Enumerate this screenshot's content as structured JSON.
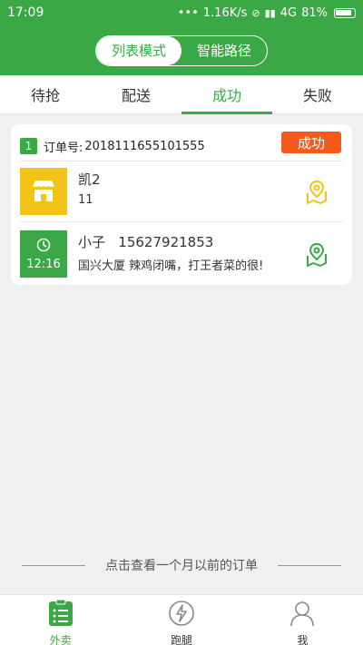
{
  "status_bar": {
    "time": "17:09",
    "dots": "•••",
    "speed": "1.16K/s",
    "network": "4G",
    "battery": "81%"
  },
  "header": {
    "modes": [
      {
        "label": "列表模式",
        "active": true
      },
      {
        "label": "智能路径",
        "active": false
      }
    ]
  },
  "tabs": [
    {
      "label": "待抢"
    },
    {
      "label": "配送"
    },
    {
      "label": "成功",
      "active": true
    },
    {
      "label": "失败"
    }
  ],
  "order": {
    "index": "1",
    "number_label": "订单号:",
    "number": "2018111655101555",
    "status": "成功",
    "pickup": {
      "name": "凯2",
      "address": "11"
    },
    "delivery": {
      "time": "12:16",
      "name_phone": "小子   15627921853",
      "address": "国兴大厦 辣鸡闭嘴，打王者菜的很!"
    }
  },
  "history_link": "点击查看一个月以前的订单",
  "bottom_nav": [
    {
      "label": "外卖",
      "icon": "list-icon",
      "active": true
    },
    {
      "label": "跑腿",
      "icon": "lightning-icon",
      "active": false
    },
    {
      "label": "我",
      "icon": "person-icon",
      "active": false
    }
  ],
  "colors": {
    "primary_green": "#3aa945",
    "success_orange": "#f35a1c",
    "shop_yellow": "#f2c318"
  }
}
